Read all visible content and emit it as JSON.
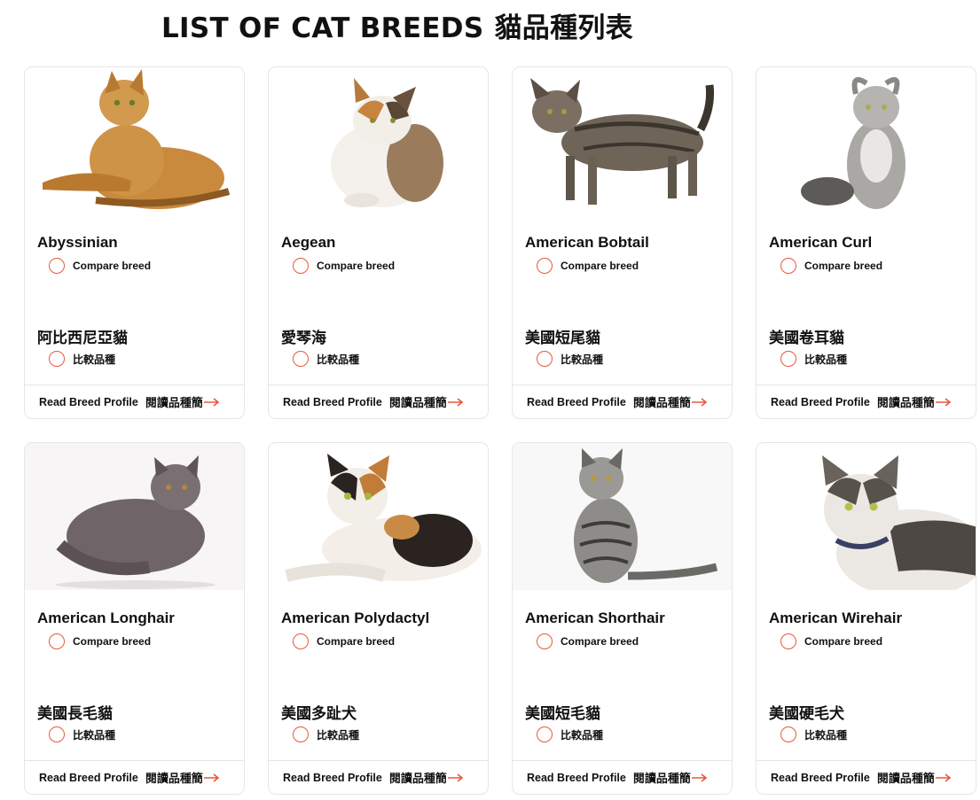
{
  "header": {
    "title_en": "LIST OF CAT BREEDS",
    "title_zh": "貓品種列表"
  },
  "colors": {
    "accent": "#e8583a",
    "card_border": "#e6e6e6"
  },
  "breeds": [
    {
      "name": "Abyssinian",
      "name_zh": "阿比西尼亞貓",
      "compare_label": "Compare breed",
      "compare_label_zh": "比較品種",
      "read_label": "Read Breed Profile",
      "read_label_zh": "閱讀品種簡",
      "image": "cat-photo-abyssinian"
    },
    {
      "name": "Aegean",
      "name_zh": "愛琴海",
      "compare_label": "Compare breed",
      "compare_label_zh": "比較品種",
      "read_label": "Read Breed Profile",
      "read_label_zh": "閱讀品種簡",
      "image": "cat-photo-aegean"
    },
    {
      "name": "American Bobtail",
      "name_zh": "美國短尾貓",
      "compare_label": "Compare breed",
      "compare_label_zh": "比較品種",
      "read_label": "Read Breed Profile",
      "read_label_zh": "閱讀品種簡",
      "image": "cat-photo-american-bobtail"
    },
    {
      "name": "American Curl",
      "name_zh": "美國卷耳貓",
      "compare_label": "Compare breed",
      "compare_label_zh": "比較品種",
      "read_label": "Read Breed Profile",
      "read_label_zh": "閱讀品種簡",
      "image": "cat-photo-american-curl"
    },
    {
      "name": "American Longhair",
      "name_zh": "美國長毛貓",
      "compare_label": "Compare breed",
      "compare_label_zh": "比較品種",
      "read_label": "Read Breed Profile",
      "read_label_zh": "閱讀品種簡",
      "image": "cat-photo-american-longhair"
    },
    {
      "name": "American Polydactyl",
      "name_zh": "美國多趾犬",
      "compare_label": "Compare breed",
      "compare_label_zh": "比較品種",
      "read_label": "Read Breed Profile",
      "read_label_zh": "閱讀品種簡",
      "image": "cat-photo-american-polydactyl"
    },
    {
      "name": "American Shorthair",
      "name_zh": "美國短毛貓",
      "compare_label": "Compare breed",
      "compare_label_zh": "比較品種",
      "read_label": "Read Breed Profile",
      "read_label_zh": "閱讀品種簡",
      "image": "cat-photo-american-shorthair"
    },
    {
      "name": "American Wirehair",
      "name_zh": "美國硬毛犬",
      "compare_label": "Compare breed",
      "compare_label_zh": "比較品種",
      "read_label": "Read Breed Profile",
      "read_label_zh": "閱讀品種簡",
      "image": "cat-photo-american-wirehair"
    }
  ]
}
